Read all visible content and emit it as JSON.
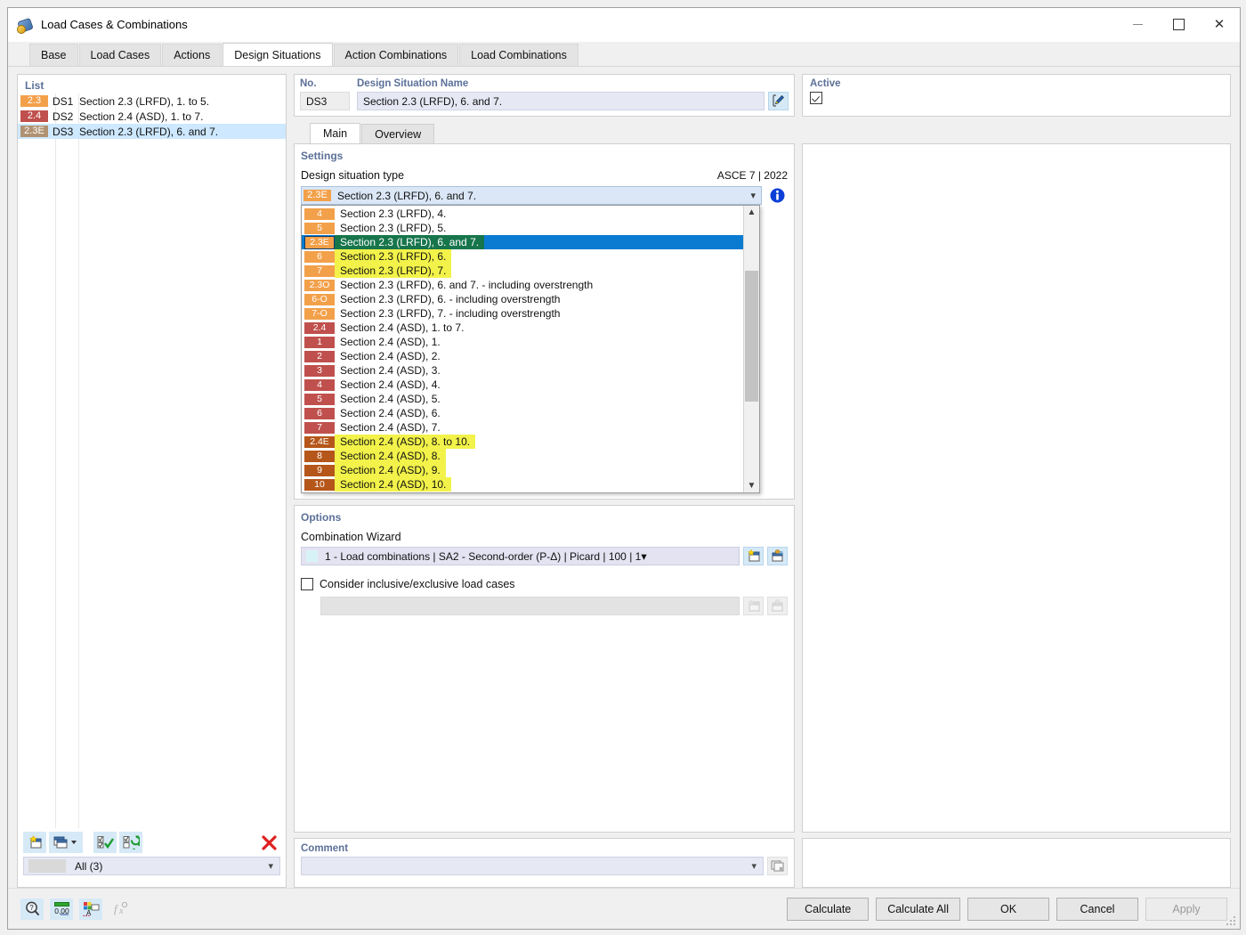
{
  "window": {
    "title": "Load Cases & Combinations",
    "minimize_label": "Minimize",
    "maximize_label": "Maximize",
    "close_label": "Close"
  },
  "tabs": [
    {
      "label": "Base",
      "active": false
    },
    {
      "label": "Load Cases",
      "active": false
    },
    {
      "label": "Actions",
      "active": false
    },
    {
      "label": "Design Situations",
      "active": true
    },
    {
      "label": "Action Combinations",
      "active": false
    },
    {
      "label": "Load Combinations",
      "active": false
    }
  ],
  "list_panel": {
    "caption": "List",
    "rows": [
      {
        "badge": "2.3",
        "badge_color": "#f3a04a",
        "no": "DS1",
        "text": "Section 2.3 (LRFD), 1. to 5.",
        "selected": false
      },
      {
        "badge": "2.4",
        "badge_color": "#c0504d",
        "no": "DS2",
        "text": "Section 2.4 (ASD), 1. to 7.",
        "selected": false
      },
      {
        "badge": "2.3E",
        "badge_color": "#b09272",
        "no": "DS3",
        "text": "Section 2.3 (LRFD), 6. and 7.",
        "selected": true
      }
    ],
    "toolbar": [
      {
        "name": "new-design-situation-button",
        "icon": "new-window-icon"
      },
      {
        "name": "copy-design-situation-button",
        "icon": "copy-window-dropdown-icon"
      },
      {
        "name": "select-all-button",
        "icon": "check-all-icon"
      },
      {
        "name": "invert-selection-button",
        "icon": "invert-selection-icon"
      },
      {
        "name": "delete-button",
        "icon": "red-x-icon"
      }
    ],
    "filter": {
      "label": "All (3)",
      "chevron": "chevron-down-icon"
    }
  },
  "no_field": {
    "caption": "No.",
    "value": "DS3"
  },
  "name_field": {
    "caption": "Design Situation Name",
    "value": "Section 2.3 (LRFD), 6. and 7.",
    "edit_button": "edit-pencil-icon"
  },
  "active_field": {
    "caption": "Active",
    "checked": true
  },
  "inner_tabs": [
    {
      "label": "Main",
      "active": true
    },
    {
      "label": "Overview",
      "active": false
    }
  ],
  "settings": {
    "caption": "Settings",
    "label": "Design situation type",
    "standard": "ASCE 7 | 2022",
    "info_button": "info-icon",
    "selected": {
      "badge": "2.3E",
      "badge_color": "#f3a04a",
      "text": "Section 2.3 (LRFD), 6. and 7."
    },
    "dropdown_items": [
      {
        "badge": "4",
        "badge_color": "#f3a04a",
        "text": "Section 2.3 (LRFD), 4.",
        "row_bg": "",
        "state": "normal"
      },
      {
        "badge": "5",
        "badge_color": "#f3a04a",
        "text": "Section 2.3 (LRFD), 5.",
        "row_bg": "",
        "state": "normal"
      },
      {
        "badge": "2.3E",
        "badge_color": "#f3a04a",
        "text": "Section 2.3 (LRFD), 6. and 7.",
        "row_bg": "#0a7bd1",
        "text_bg": "#17754c",
        "state": "highlight"
      },
      {
        "badge": "6",
        "badge_color": "#f3a04a",
        "text": "Section 2.3 (LRFD), 6.",
        "text_bg": "#f2f24a",
        "state": "marked"
      },
      {
        "badge": "7",
        "badge_color": "#f3a04a",
        "text": "Section 2.3 (LRFD), 7.",
        "text_bg": "#f2f24a",
        "state": "marked"
      },
      {
        "badge": "2.3O",
        "badge_color": "#f3a04a",
        "text": "Section 2.3 (LRFD), 6. and 7. - including overstrength",
        "state": "normal"
      },
      {
        "badge": "6-O",
        "badge_color": "#f3a04a",
        "text": "Section 2.3 (LRFD), 6. - including overstrength",
        "state": "normal"
      },
      {
        "badge": "7-O",
        "badge_color": "#f3a04a",
        "text": "Section 2.3 (LRFD), 7. - including overstrength",
        "state": "normal"
      },
      {
        "badge": "2.4",
        "badge_color": "#c0504d",
        "text": "Section 2.4 (ASD), 1. to 7.",
        "state": "normal"
      },
      {
        "badge": "1",
        "badge_color": "#c0504d",
        "text": "Section 2.4 (ASD), 1.",
        "state": "normal"
      },
      {
        "badge": "2",
        "badge_color": "#c0504d",
        "text": "Section 2.4 (ASD), 2.",
        "state": "normal"
      },
      {
        "badge": "3",
        "badge_color": "#c0504d",
        "text": "Section 2.4 (ASD), 3.",
        "state": "normal"
      },
      {
        "badge": "4",
        "badge_color": "#c0504d",
        "text": "Section 2.4 (ASD), 4.",
        "state": "normal"
      },
      {
        "badge": "5",
        "badge_color": "#c0504d",
        "text": "Section 2.4 (ASD), 5.",
        "state": "normal"
      },
      {
        "badge": "6",
        "badge_color": "#c0504d",
        "text": "Section 2.4 (ASD), 6.",
        "state": "normal"
      },
      {
        "badge": "7",
        "badge_color": "#c0504d",
        "text": "Section 2.4 (ASD), 7.",
        "state": "normal"
      },
      {
        "badge": "2.4E",
        "badge_color": "#b5561a",
        "text": "Section 2.4 (ASD), 8. to 10.",
        "text_bg": "#f2f24a",
        "state": "marked"
      },
      {
        "badge": "8",
        "badge_color": "#b5561a",
        "text": "Section 2.4 (ASD), 8.",
        "text_bg": "#f2f24a",
        "state": "marked"
      },
      {
        "badge": "9",
        "badge_color": "#b5561a",
        "text": "Section 2.4 (ASD), 9.",
        "text_bg": "#f2f24a",
        "state": "marked"
      },
      {
        "badge": "10",
        "badge_color": "#b5561a",
        "text": "Section 2.4 (ASD), 10.",
        "text_bg": "#f2f24a",
        "state": "marked"
      }
    ],
    "scroll_up": "scroll-up-arrow-icon",
    "scroll_down": "scroll-down-arrow-icon"
  },
  "options": {
    "caption": "Options",
    "wizard_label": "Combination Wizard",
    "wizard_value": "1 - Load combinations | SA2 - Second-order (P-Δ) | Picard | 100 | 1",
    "wizard_new_button": "new-wizard-icon",
    "wizard_edit_button": "edit-wizard-icon",
    "checkbox_label": "Consider inclusive/exclusive load cases",
    "checkbox_checked": false,
    "disabled_new_button": "new-wizard-icon-disabled",
    "disabled_edit_button": "edit-wizard-icon-disabled"
  },
  "comment": {
    "caption": "Comment",
    "value": "",
    "chevron": "chevron-down-icon",
    "button": "comment-library-icon"
  },
  "footer": {
    "tool_buttons": [
      {
        "name": "help-magnifier-button",
        "icon": "magnifier-question-icon",
        "disabled": false
      },
      {
        "name": "units-button",
        "icon": "decimal-places-icon",
        "disabled": false
      },
      {
        "name": "display-properties-button",
        "icon": "colors-display-icon",
        "disabled": false
      },
      {
        "name": "formula-button",
        "icon": "function-icon",
        "disabled": true
      }
    ],
    "buttons": [
      {
        "label": "Calculate",
        "disabled": false,
        "name": "calculate-button"
      },
      {
        "label": "Calculate All",
        "disabled": false,
        "name": "calculate-all-button"
      },
      {
        "label": "OK",
        "disabled": false,
        "name": "ok-button"
      },
      {
        "label": "Cancel",
        "disabled": false,
        "name": "cancel-button"
      },
      {
        "label": "Apply",
        "disabled": true,
        "name": "apply-button"
      }
    ]
  },
  "colors": {
    "accent_blue": "#0a7bd1",
    "caption_blue": "#5b7098",
    "highlight_green": "#17754c",
    "mark_yellow": "#f2f24a",
    "orange": "#f3a04a",
    "red": "#c0504d",
    "selection_row": "#cde8ff"
  }
}
